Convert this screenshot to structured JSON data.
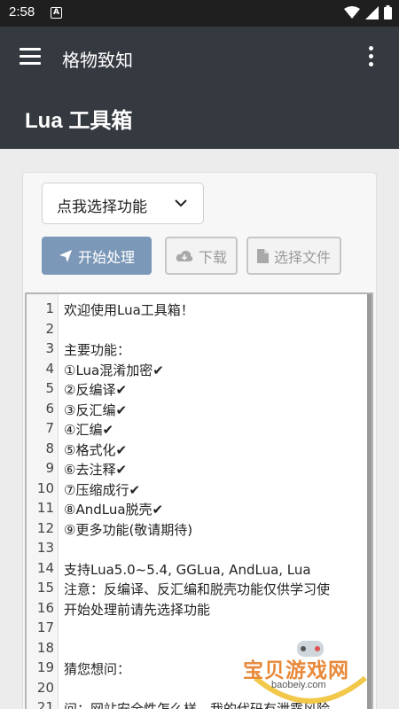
{
  "status_bar": {
    "time": "2:58",
    "notification_badge": "A",
    "icons": [
      "wifi-icon",
      "signal-icon",
      "battery-icon"
    ]
  },
  "app_bar": {
    "title": "格物致知",
    "menu_icon": "hamburger-menu-icon",
    "overflow_icon": "more-vert-icon"
  },
  "header": {
    "title": "Lua 工具箱"
  },
  "toolbar": {
    "select_label": "点我选择功能",
    "start_label": "开始处理",
    "download_label": "下载",
    "choose_file_label": "选择文件"
  },
  "editor": {
    "line_numbers": [
      "1",
      "2",
      "3",
      "4",
      "5",
      "6",
      "7",
      "8",
      "9",
      "10",
      "11",
      "12",
      "13",
      "14",
      "15",
      "16",
      "17",
      "18",
      "19",
      "20",
      "21"
    ],
    "lines": [
      "欢迎使用Lua工具箱！",
      "",
      "主要功能：",
      "①Lua混淆加密✔",
      "②反编译✔",
      "③反汇编✔",
      "④汇编✔",
      "⑤格式化✔",
      "⑥去注释✔",
      "⑦压缩成行✔",
      "⑧AndLua脱壳✔",
      "⑨更多功能(敬请期待)",
      "",
      "支持Lua5.0~5.4, GGLua, AndLua, Lua",
      "注意：反编译、反汇编和脱壳功能仅供学习使",
      "开始处理前请先选择功能",
      "",
      "",
      "猜您想问：",
      "",
      "问：网站安全性怎么样，我的代码有泄露风险"
    ]
  },
  "watermark": {
    "text": "宝贝游戏网",
    "url": "baobeiy.com"
  },
  "colors": {
    "app_bar": "#353a40",
    "primary_button": "#7c98b8",
    "version_number": "#1b8a6b",
    "watermark": "#e8893a"
  }
}
